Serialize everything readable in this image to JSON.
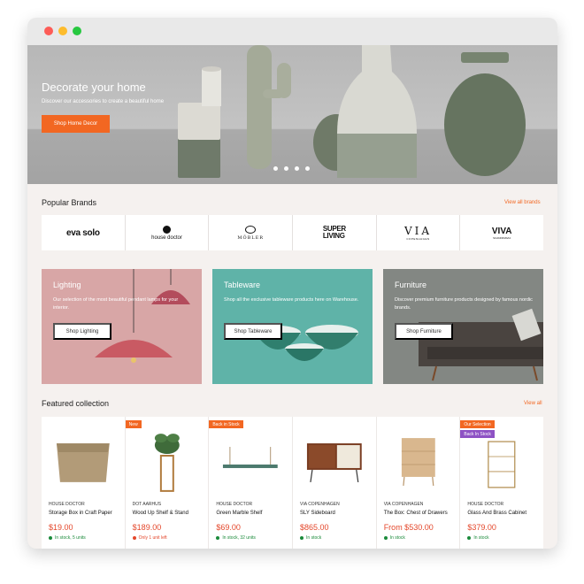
{
  "hero": {
    "title": "Decorate your home",
    "subtitle": "Discover our accessories to create a beautiful home",
    "button": "Shop Home Decor",
    "carousel_dots": 4
  },
  "brands": {
    "title": "Popular Brands",
    "view_all": "View all brands",
    "items": [
      {
        "label": "eva solo"
      },
      {
        "label": "house doctor"
      },
      {
        "label": "MÖBLER"
      },
      {
        "label": "SUPER LIVING",
        "line1": "SUPER",
        "line2": "LIVING"
      },
      {
        "label": "VIA",
        "sub": "COPENHAGEN"
      },
      {
        "label": "VIVA",
        "sub": "SCANDINAVIA"
      }
    ]
  },
  "categories": [
    {
      "title": "Lighting",
      "description": "Our selection of the most beautiful pendant lamps for your interior.",
      "button": "Shop Lighting",
      "color": "#d8a6a6"
    },
    {
      "title": "Tableware",
      "description": "Shop all the exclusive tableware products here on Warehouse.",
      "button": "Shop Tableware",
      "color": "#5fb3a8"
    },
    {
      "title": "Furniture",
      "description": "Discover premium furniture products designed by famous nordic brands.",
      "button": "Shop Furniture",
      "color": "#838783"
    }
  ],
  "featured": {
    "title": "Featured collection",
    "view_all": "View all",
    "products": [
      {
        "brand": "HOUSE DOCTOR",
        "name": "Storage Box in Craft Paper",
        "price": "$19.00",
        "stock": "In stock, 5 units",
        "stock_status": "in",
        "badges": []
      },
      {
        "brand": "DOT AARHUS",
        "name": "Wood Up Shelf & Stand",
        "price": "$189.00",
        "stock": "Only 1 unit left",
        "stock_status": "low",
        "badges": [
          "New"
        ]
      },
      {
        "brand": "HOUSE DOCTOR",
        "name": "Green Marble Shelf",
        "price": "$69.00",
        "stock": "In stock, 32 units",
        "stock_status": "in",
        "badges": [
          "Back in Stock"
        ]
      },
      {
        "brand": "VIA COPENHAGEN",
        "name": "SLY Sideboard",
        "price": "$865.00",
        "stock": "In stock",
        "stock_status": "in",
        "badges": []
      },
      {
        "brand": "VIA COPENHAGEN",
        "name": "The Box: Chest of Drawers",
        "price": "From $530.00",
        "stock": "In stock",
        "stock_status": "in",
        "badges": []
      },
      {
        "brand": "HOUSE DOCTOR",
        "name": "Glass And Brass Cabinet",
        "price": "$379.00",
        "stock": "In stock",
        "stock_status": "in",
        "badges": [
          "Our Selection",
          "Back In Stock"
        ]
      }
    ]
  },
  "colors": {
    "accent": "#f26722",
    "price": "#e4472b",
    "in_stock": "#1a8a3a",
    "badge_purple": "#8e52c4"
  }
}
